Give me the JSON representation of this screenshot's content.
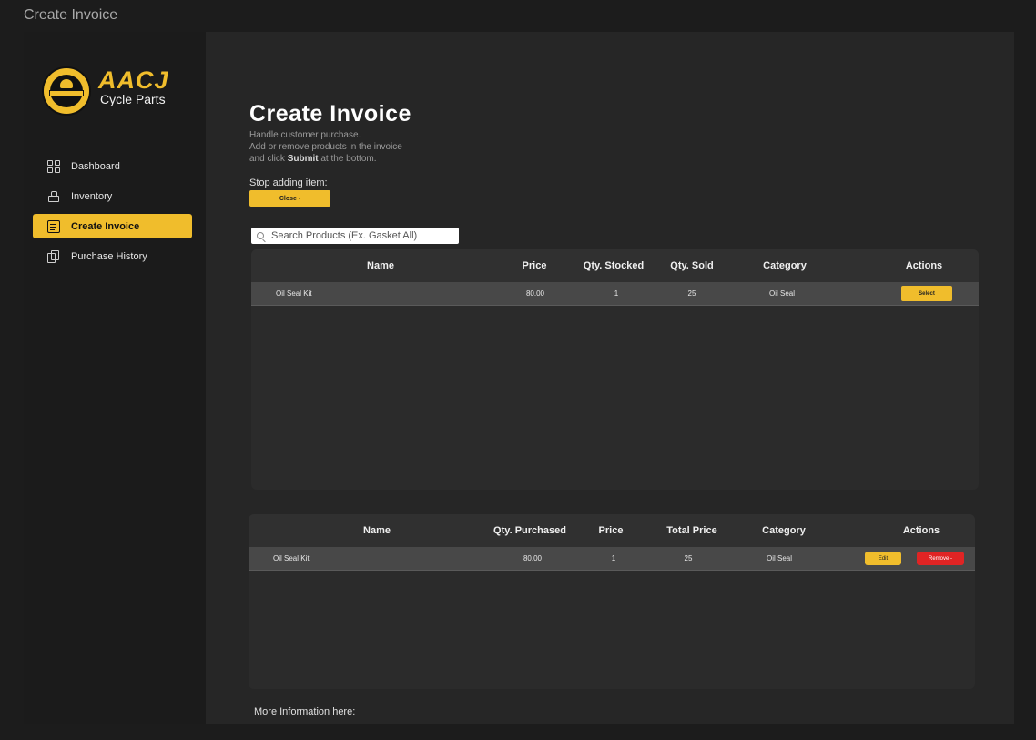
{
  "window": {
    "title": "Create Invoice"
  },
  "brand": {
    "name": "AACJ",
    "subtitle": "Cycle Parts",
    "accent": "#f0bd2c"
  },
  "sidebar": {
    "items": [
      {
        "label": "Dashboard",
        "icon": "dashboard-icon"
      },
      {
        "label": "Inventory",
        "icon": "inventory-icon"
      },
      {
        "label": "Create Invoice",
        "icon": "document-icon",
        "active": true
      },
      {
        "label": "Purchase History",
        "icon": "history-icon"
      }
    ]
  },
  "page": {
    "title": "Create Invoice",
    "desc_line1": "Handle customer purchase.",
    "desc_line2": "Add or remove products in the invoice",
    "desc_line3_pre": "and click ",
    "desc_line3_bold": "Submit",
    "desc_line3_post": " at the bottom.",
    "stop_label": "Stop adding item:",
    "close_button": "Close -"
  },
  "search": {
    "placeholder": "Search Products (Ex. Gasket All)"
  },
  "products_table": {
    "headers": [
      "Name",
      "Price",
      "Qty. Stocked",
      "Qty. Sold",
      "Category",
      "Actions"
    ],
    "rows": [
      {
        "name": "Oil Seal Kit",
        "price": "80.00",
        "stocked": "1",
        "sold": "25",
        "category": "Oil Seal",
        "action": "Select"
      }
    ]
  },
  "invoice_table": {
    "headers": [
      "Name",
      "Qty. Purchased",
      "Price",
      "Total Price",
      "Category",
      "Actions"
    ],
    "rows": [
      {
        "name": "Oil Seal Kit",
        "qty": "80.00",
        "price": "1",
        "total": "25",
        "category": "Oil Seal",
        "edit": "Edit",
        "remove": "Remove -"
      }
    ]
  },
  "footer": {
    "more_info": "More Information here:"
  },
  "colors": {
    "accent": "#f0bd2c",
    "danger": "#e02424",
    "background": "#1c1c1c",
    "panel": "#262626"
  }
}
